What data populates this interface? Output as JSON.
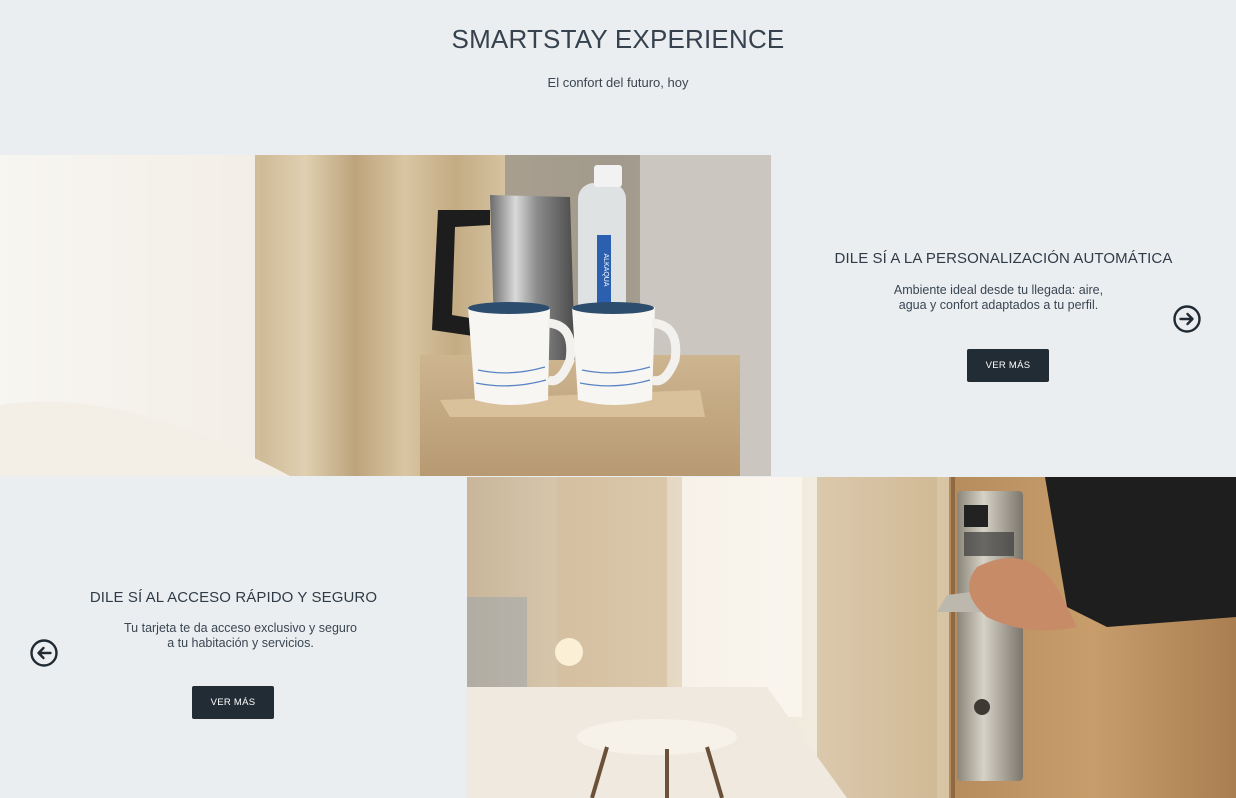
{
  "header": {
    "title": "SMARTSTAY EXPERIENCE",
    "subtitle": "El confort del futuro, hoy"
  },
  "features": [
    {
      "title": "DILE SÍ A LA PERSONALIZACIÓN AUTOMÁTICA",
      "description_line1": "Ambiente ideal desde tu llegada: aire,",
      "description_line2": "agua y confort adaptados a tu perfil.",
      "button_label": "VER MÁS",
      "nav_icon": "arrow-right-circle-icon",
      "photo_text": "ALKAQUA"
    },
    {
      "title": "DILE SÍ AL ACCESO RÁPIDO Y SEGURO",
      "description_line1": "Tu tarjeta te da acceso exclusivo y seguro",
      "description_line2": "a tu habitación y servicios.",
      "button_label": "VER MÁS",
      "nav_icon": "arrow-left-circle-icon"
    }
  ],
  "colors": {
    "background": "#ebeef1",
    "button": "#222c35",
    "text": "#2e3a45"
  }
}
